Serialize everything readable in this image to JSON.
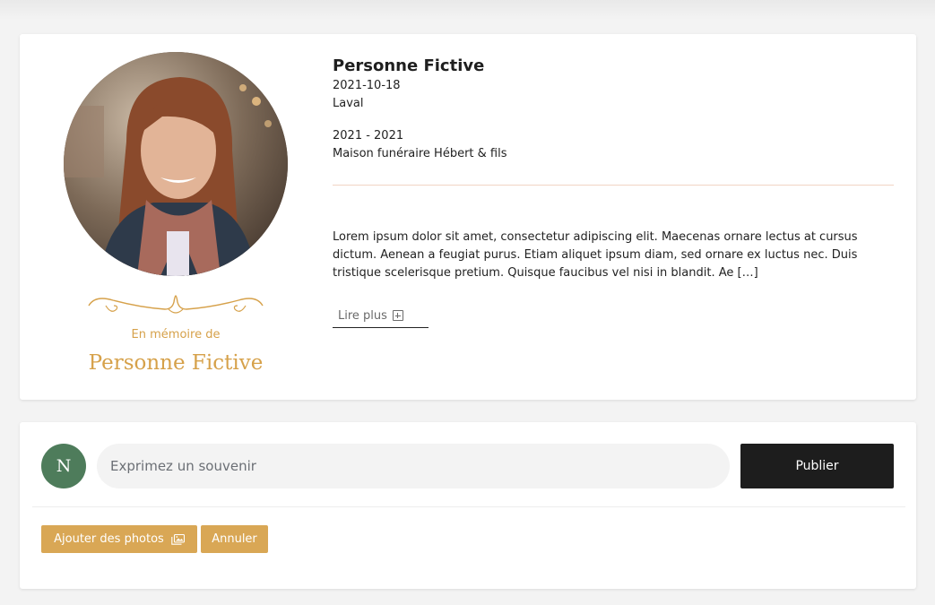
{
  "profile": {
    "name": "Personne Fictive",
    "birth_date": "2021-10-18",
    "city": "Laval",
    "years": "2021 - 2021",
    "funeral_home": "Maison funéraire Hébert & fils",
    "bio": "Lorem ipsum dolor sit amet, consectetur adipiscing elit. Maecenas ornare lectus at cursus dictum. Aenean a feugiat purus. Etiam aliquet ipsum diam, sed ornare ex luctus nec. Duis tristique scelerisque pretium. Quisque faucibus vel nisi in blandit. Ae […]",
    "read_more_label": "Lire plus",
    "memory_label": "En mémoire de",
    "memorial_name": "Personne Fictive"
  },
  "memory_form": {
    "avatar_initial": "N",
    "placeholder": "Exprimez un souvenir",
    "publish_label": "Publier",
    "add_photos_label": "Ajouter des photos",
    "cancel_label": "Annuler"
  },
  "icons": {
    "read_more": "plus-square-icon",
    "add_photos": "photos-icon",
    "ornament": "flourish-ornament"
  },
  "colors": {
    "accent_gold": "#d6a14a",
    "button_gold": "#d9a755",
    "avatar_green": "#4e7c5b",
    "publish_dark": "#1d1d1d"
  }
}
